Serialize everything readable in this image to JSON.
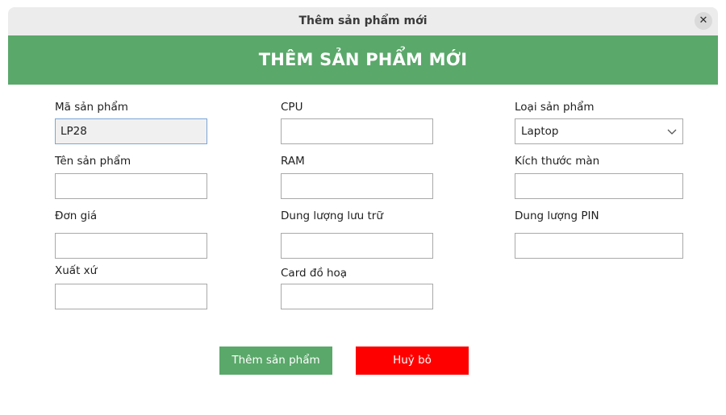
{
  "window": {
    "title": "Thêm sản phẩm mới",
    "close_icon": "✕"
  },
  "banner": {
    "heading": "THÊM SẢN PHẨM MỚI"
  },
  "form": {
    "ma_san_pham": {
      "label": "Mã sản phẩm",
      "value": "LP28"
    },
    "ten_san_pham": {
      "label": "Tên sản phẩm",
      "value": ""
    },
    "don_gia": {
      "label": "Đơn giá",
      "value": ""
    },
    "xuat_xu": {
      "label": "Xuất xứ",
      "value": ""
    },
    "cpu": {
      "label": "CPU",
      "value": ""
    },
    "ram": {
      "label": "RAM",
      "value": ""
    },
    "dung_luong_luu_tru": {
      "label": "Dung lượng lưu trữ",
      "value": ""
    },
    "card_do_hoa": {
      "label": "Card đồ hoạ",
      "value": ""
    },
    "loai_san_pham": {
      "label": "Loại sản phẩm",
      "selected": "Laptop"
    },
    "kich_thuoc_man": {
      "label": "Kích thước màn",
      "value": ""
    },
    "dung_luong_pin": {
      "label": "Dung lượng PIN",
      "value": ""
    }
  },
  "actions": {
    "add_label": "Thêm sản phẩm",
    "cancel_label": "Huỷ bỏ"
  },
  "colors": {
    "accent_green": "#5aa86a",
    "cancel_red": "#ff0000"
  }
}
